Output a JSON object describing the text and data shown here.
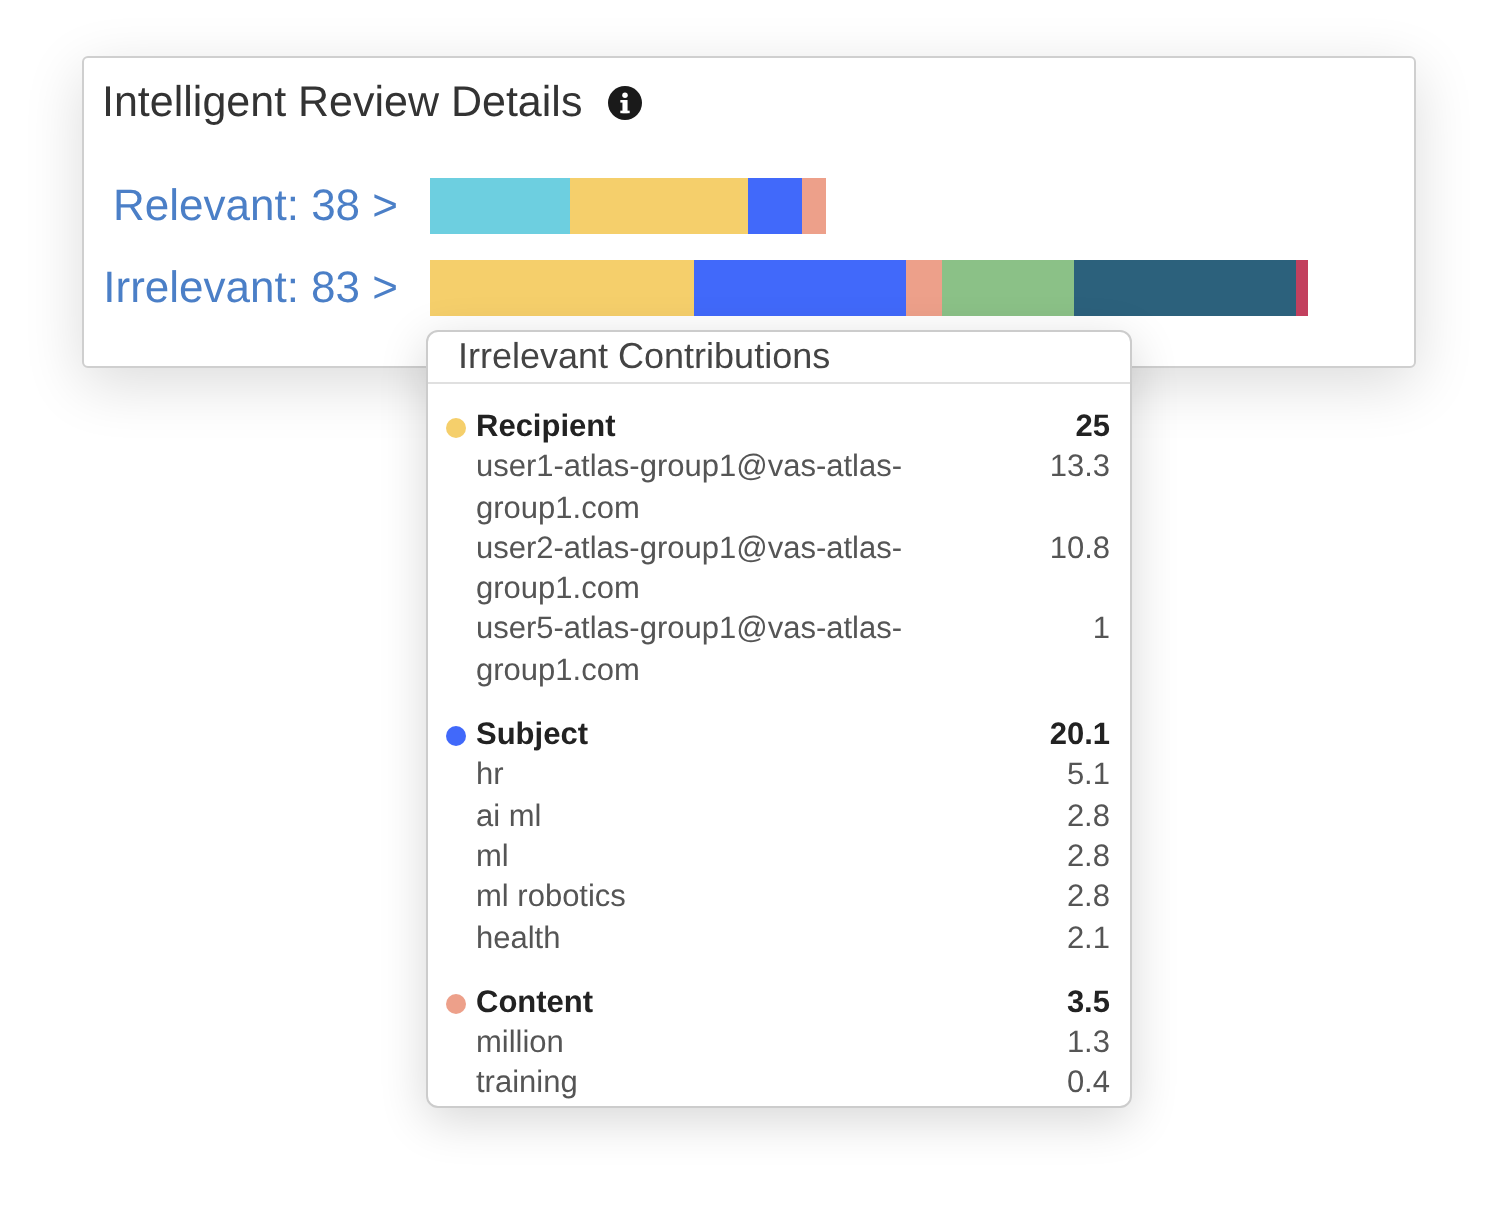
{
  "card": {
    "title": "Intelligent Review Details",
    "rows": [
      {
        "label": "Relevant: 38 >",
        "segments": [
          {
            "color": "#6dcfe0"
          },
          {
            "color": "#f5cf6b"
          },
          {
            "color": "#4169fa"
          },
          {
            "color": "#eda08a"
          }
        ]
      },
      {
        "label": "Irrelevant: 83 >",
        "segments": [
          {
            "color": "#f5cf6b"
          },
          {
            "color": "#4169fa"
          },
          {
            "color": "#eda08a"
          },
          {
            "color": "#8bc187"
          },
          {
            "color": "#2c617c"
          },
          {
            "color": "#c2405e"
          }
        ]
      }
    ]
  },
  "tooltip": {
    "title": "Irrelevant Contributions",
    "groups": [
      {
        "name": "Recipient",
        "color": "#f5cf6b",
        "value": "25",
        "items": [
          {
            "name": "user1-atlas-group1@vas-atlas-group1.com",
            "value": "13.3"
          },
          {
            "name": "user2-atlas-group1@vas-atlas-group1.com",
            "value": "10.8"
          },
          {
            "name": "user5-atlas-group1@vas-atlas-group1.com",
            "value": "1"
          }
        ]
      },
      {
        "name": "Subject",
        "color": "#4169fa",
        "value": "20.1",
        "items": [
          {
            "name": "hr",
            "value": "5.1"
          },
          {
            "name": "ai ml",
            "value": "2.8"
          },
          {
            "name": "ml",
            "value": "2.8"
          },
          {
            "name": "ml robotics",
            "value": "2.8"
          },
          {
            "name": "health",
            "value": "2.1"
          }
        ]
      },
      {
        "name": "Content",
        "color": "#eda08a",
        "value": "3.5",
        "items": [
          {
            "name": "million",
            "value": "1.3"
          },
          {
            "name": "training",
            "value": "0.4"
          }
        ]
      }
    ]
  }
}
